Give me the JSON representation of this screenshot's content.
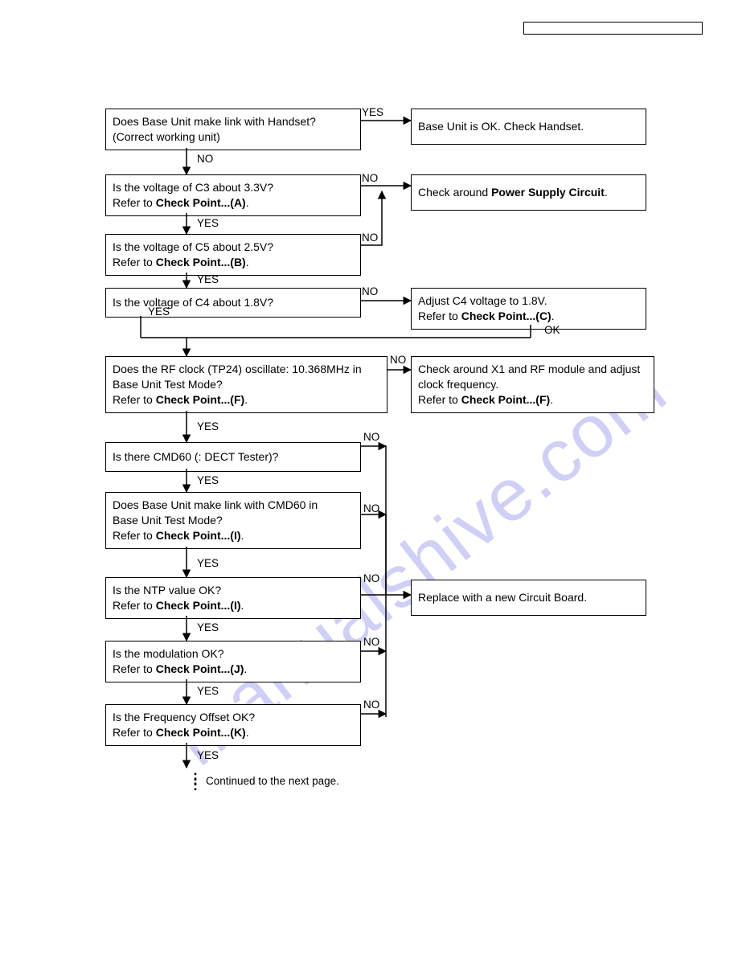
{
  "boxes": {
    "q1": {
      "lines": [
        "Does Base Unit make link with Handset?",
        "(Correct working unit)"
      ]
    },
    "r1": {
      "lines": [
        "Base Unit is OK. Check Handset."
      ]
    },
    "q2": {
      "lines": [
        "Is the voltage of C3 about 3.3V?",
        "Refer to <b>Check Point...(A)</b>."
      ]
    },
    "r2": {
      "lines": [
        "Check around <b>Power Supply Circuit</b>."
      ]
    },
    "q3": {
      "lines": [
        "Is the voltage of C5 about 2.5V?",
        "Refer to <b>Check Point...(B)</b>."
      ]
    },
    "q4": {
      "lines": [
        "Is the voltage of C4 about 1.8V?"
      ]
    },
    "r4": {
      "lines": [
        "Adjust C4 voltage to 1.8V.",
        "Refer to <b>Check Point...(C)</b>."
      ]
    },
    "q5": {
      "lines": [
        "Does the RF clock (TP24) oscillate: 10.368MHz in",
        "Base Unit Test Mode?",
        "Refer to <b>Check Point...(F)</b>."
      ]
    },
    "r5": {
      "lines": [
        "Check around X1 and RF module and adjust",
        "clock frequency.",
        "Refer to <b>Check Point...(F)</b>."
      ]
    },
    "q6": {
      "lines": [
        "Is there CMD60 (: DECT Tester)?"
      ]
    },
    "q7": {
      "lines": [
        "Does Base Unit make link with CMD60 in",
        "Base Unit Test Mode?",
        "Refer to <b>Check Point...(I)</b>."
      ]
    },
    "q8": {
      "lines": [
        "Is the NTP value OK?",
        "Refer to <b>Check Point...(I)</b>."
      ]
    },
    "r8": {
      "lines": [
        "Replace with a new Circuit Board."
      ]
    },
    "q9": {
      "lines": [
        "Is the modulation OK?",
        "Refer to <b>Check Point...(J)</b>."
      ]
    },
    "q10": {
      "lines": [
        "Is the Frequency Offset OK?",
        "Refer to <b>Check Point...(K)</b>."
      ]
    }
  },
  "labels": {
    "yes": "YES",
    "no": "NO",
    "ok": "OK",
    "continued": "Continued to the next page."
  },
  "watermark": "manualshive.com"
}
